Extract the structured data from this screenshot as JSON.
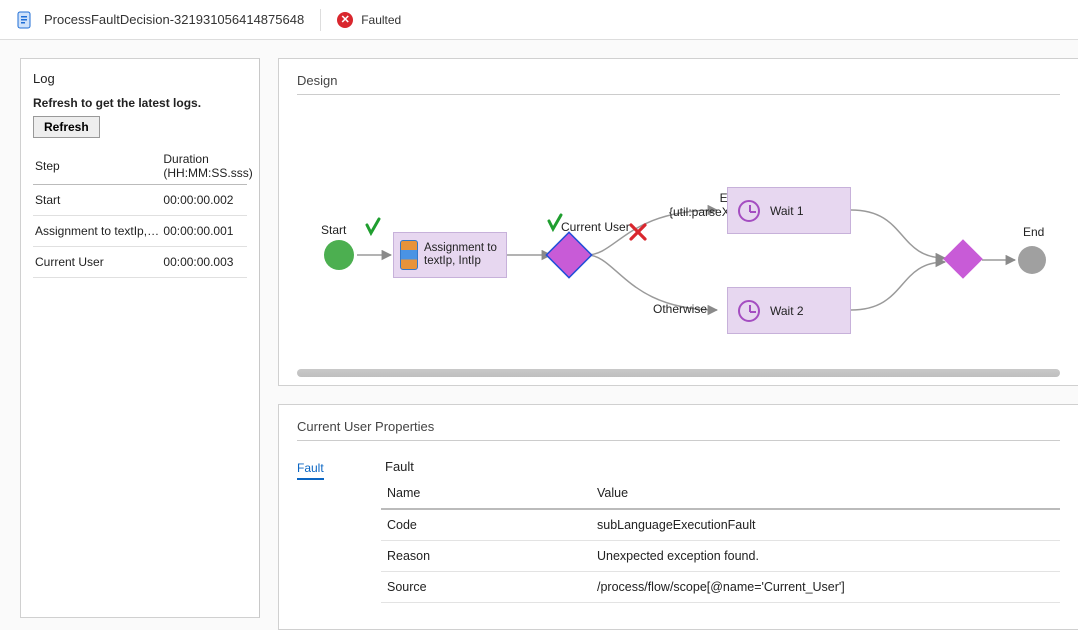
{
  "header": {
    "title": "ProcessFaultDecision-321931056414875648",
    "status_label": "Faulted"
  },
  "log": {
    "heading": "Log",
    "note": "Refresh to get the latest logs.",
    "refresh_label": "Refresh",
    "col_step": "Step",
    "col_duration": "Duration (HH:MM:SS.sss)",
    "rows": [
      {
        "step": "Start",
        "duration": "00:00:00.002"
      },
      {
        "step": "Assignment to textIp, In...",
        "duration": "00:00:00.001"
      },
      {
        "step": "Current User",
        "duration": "00:00:00.003"
      }
    ]
  },
  "design": {
    "heading": "Design",
    "start_label": "Start",
    "assign_label_line1": "Assignment to",
    "assign_label_line2": "textIp, IntIp",
    "decision_label": "Current User",
    "branch_top_label": "Equals",
    "branch_top_expr": "{util:parseXML...",
    "branch_bottom_label": "Otherwise",
    "wait1_label": "Wait 1",
    "wait2_label": "Wait 2",
    "end_label": "End"
  },
  "props": {
    "heading_prefix": "Current User",
    "heading_suffix": " Properties",
    "tab_label": "Fault",
    "section_label": "Fault",
    "col_name": "Name",
    "col_value": "Value",
    "rows": [
      {
        "name": "Code",
        "value": "subLanguageExecutionFault"
      },
      {
        "name": "Reason",
        "value": "Unexpected exception found."
      },
      {
        "name": "Source",
        "value": "/process/flow/scope[@name='Current_User']"
      }
    ]
  }
}
